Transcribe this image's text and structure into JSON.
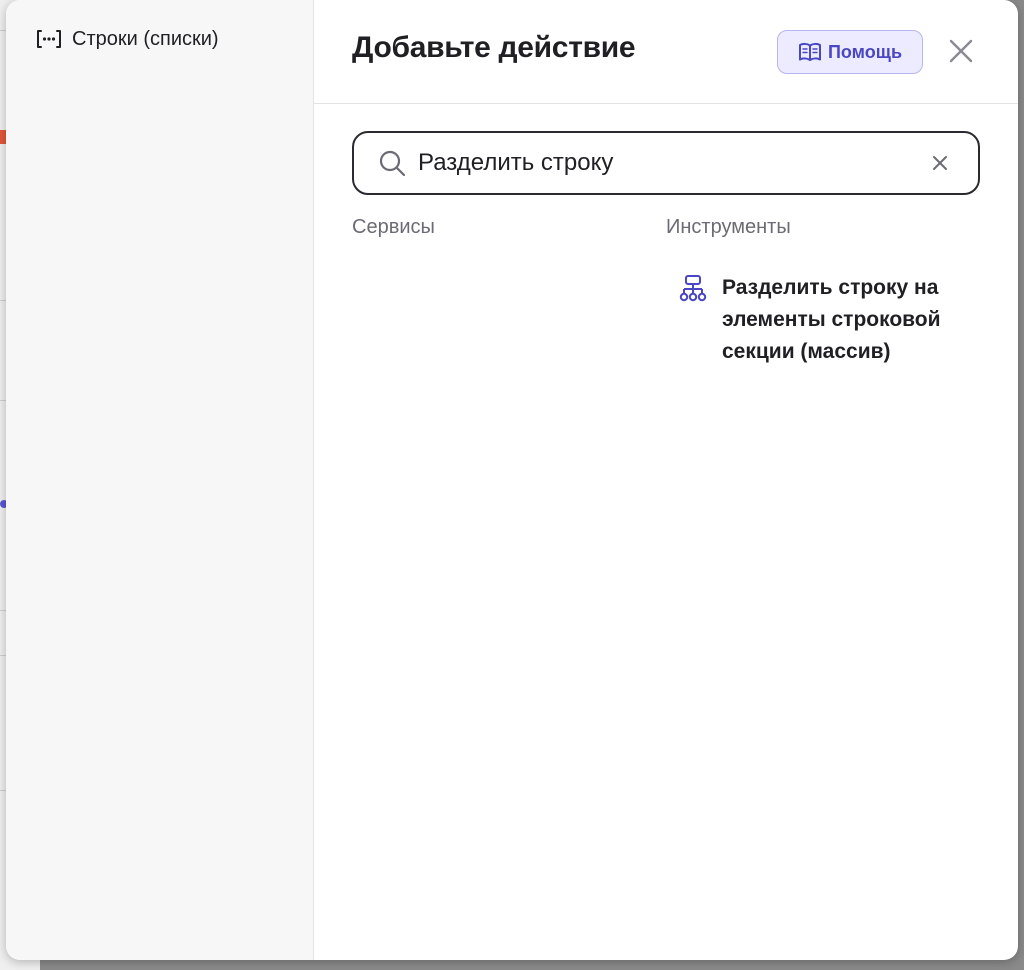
{
  "sidebar": {
    "items": [
      {
        "label": "Строки (списки)",
        "icon": "brackets-ellipsis-icon"
      }
    ]
  },
  "header": {
    "title": "Добавьте действие",
    "help_label": "Помощь",
    "help_icon": "book-icon",
    "close_icon": "close-icon"
  },
  "search": {
    "value": "Разделить строку",
    "icon": "search-icon",
    "clear_icon": "clear-icon"
  },
  "columns": {
    "services_label": "Сервисы",
    "tools_label": "Инструменты"
  },
  "results": {
    "tools": [
      {
        "label": "Разделить строку на элементы строковой секции (массив)",
        "icon": "hierarchy-icon"
      }
    ]
  },
  "colors": {
    "accent": "#4a47c4",
    "accent_bg": "#ecebff",
    "text": "#1f1f24",
    "muted": "#6b6b75"
  }
}
